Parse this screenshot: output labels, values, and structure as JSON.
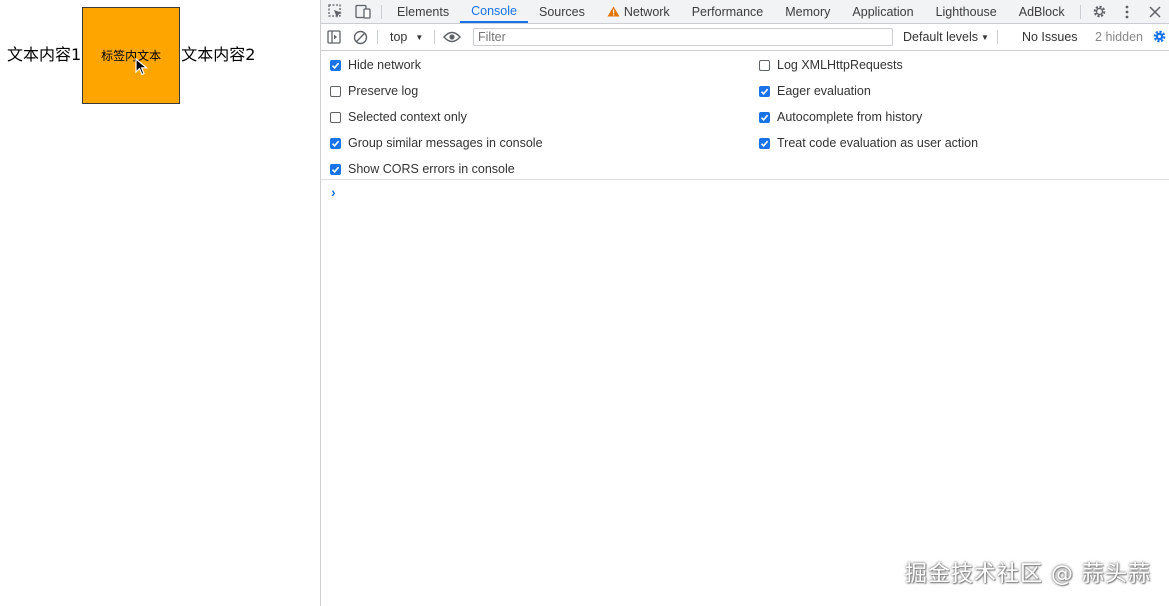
{
  "page": {
    "text_before": "文本内容1",
    "box_label": "标签内文本",
    "text_after": "文本内容2",
    "box_color": "#ffa500"
  },
  "devtools": {
    "tabs": [
      {
        "label": "Elements",
        "active": false
      },
      {
        "label": "Console",
        "active": true
      },
      {
        "label": "Sources",
        "active": false
      },
      {
        "label": "Network",
        "active": false,
        "icon": "warning-icon"
      },
      {
        "label": "Performance",
        "active": false
      },
      {
        "label": "Memory",
        "active": false
      },
      {
        "label": "Application",
        "active": false
      },
      {
        "label": "Lighthouse",
        "active": false
      },
      {
        "label": "AdBlock",
        "active": false
      }
    ],
    "toolbar": {
      "context": "top",
      "filter_placeholder": "Filter",
      "levels": "Default levels",
      "issues": "No Issues",
      "hidden": "2 hidden"
    },
    "settings_left": [
      {
        "label": "Hide network",
        "checked": true
      },
      {
        "label": "Preserve log",
        "checked": false
      },
      {
        "label": "Selected context only",
        "checked": false
      },
      {
        "label": "Group similar messages in console",
        "checked": true
      },
      {
        "label": "Show CORS errors in console",
        "checked": true
      }
    ],
    "settings_right": [
      {
        "label": "Log XMLHttpRequests",
        "checked": false
      },
      {
        "label": "Eager evaluation",
        "checked": true
      },
      {
        "label": "Autocomplete from history",
        "checked": true
      },
      {
        "label": "Treat code evaluation as user action",
        "checked": true
      }
    ],
    "prompt_symbol": "›",
    "accent_color": "#1a73e8"
  },
  "watermark": "掘金技术社区 @ 蒜头蒜"
}
